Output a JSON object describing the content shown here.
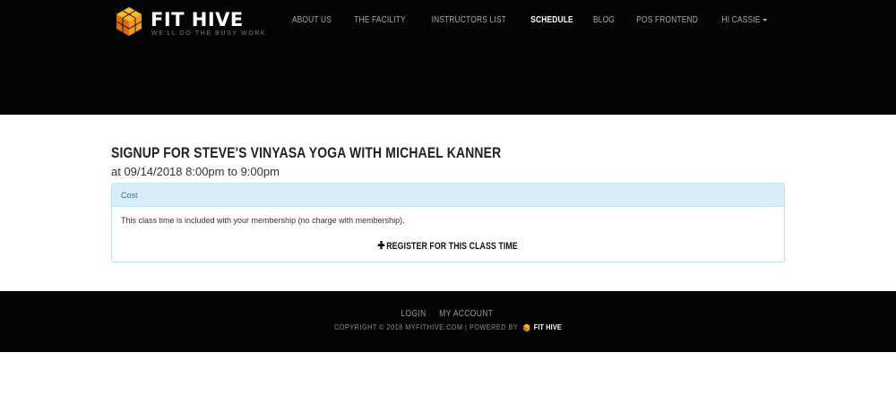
{
  "brand": {
    "name": "FIT HIVE",
    "tagline": "WE'LL DO THE BUSY WORK",
    "colors": {
      "orange": "#f29a1f",
      "gold": "#fbb92a",
      "dark_orange": "#d66d12"
    }
  },
  "nav": {
    "items": [
      {
        "label": "ABOUT US",
        "active": false
      },
      {
        "label": "THE FACILITY",
        "active": false
      },
      {
        "label": "INSTRUCTORS LIST",
        "active": false
      },
      {
        "label": "SCHEDULE",
        "active": true
      },
      {
        "label": "BLOG",
        "active": false
      },
      {
        "label": "POS FRONTEND",
        "active": false
      }
    ],
    "user_menu": "HI CASSIE"
  },
  "signup": {
    "title": "SIGNUP FOR STEVE'S VINYASA YOGA WITH MICHAEL KANNER",
    "when": "at 09/14/2018 8:00pm to  9:00pm"
  },
  "cost_panel": {
    "heading": "Cost",
    "body": "This class time is included with your membership (no charge with membership).",
    "register_label": "REGISTER FOR THIS CLASS TIME",
    "register_icon": "plus-icon"
  },
  "footer": {
    "links": [
      "LOGIN",
      "MY ACCOUNT"
    ],
    "copyright": "COPYRIGHT © 2018 MYFITHIVE.COM  |  POWERED BY",
    "powered_brand": "FIT HIVE"
  }
}
